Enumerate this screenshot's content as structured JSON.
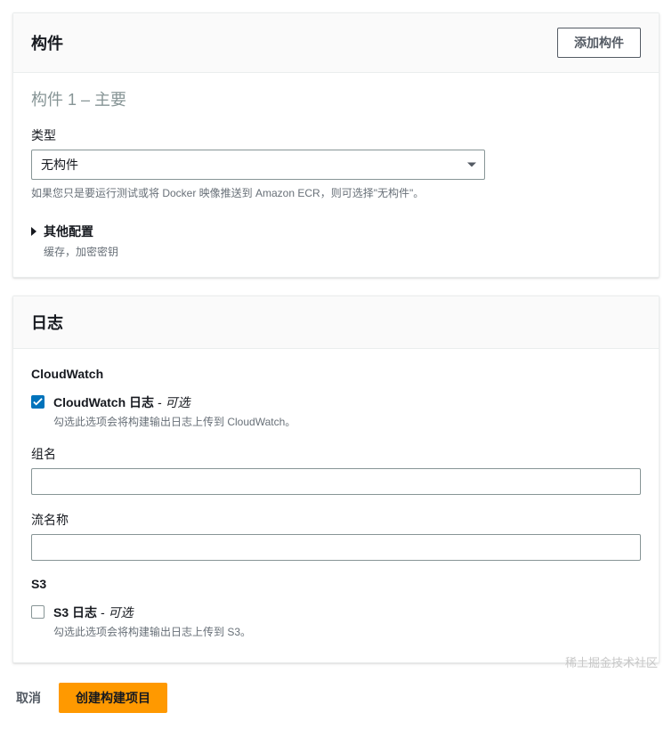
{
  "artifacts": {
    "header_title": "构件",
    "add_button": "添加构件",
    "section_title": "构件 1 – 主要",
    "type_label": "类型",
    "type_value": "无构件",
    "type_hint": "如果您只是要运行测试或将 Docker 映像推送到 Amazon ECR，则可选择\"无构件\"。",
    "other_config_title": "其他配置",
    "other_config_sub": "缓存，加密密钥"
  },
  "logs": {
    "header_title": "日志",
    "cloudwatch": {
      "section": "CloudWatch",
      "label": "CloudWatch 日志",
      "optional": " - 可选",
      "hint": "勾选此选项会将构建输出日志上传到 CloudWatch。",
      "group_label": "组名",
      "group_value": "",
      "stream_label": "流名称",
      "stream_value": ""
    },
    "s3": {
      "section": "S3",
      "label": "S3 日志",
      "optional": " - 可选",
      "hint": "勾选此选项会将构建输出日志上传到 S3。"
    }
  },
  "footer": {
    "cancel": "取消",
    "create": "创建构建项目"
  },
  "watermark": "稀土掘金技术社区"
}
